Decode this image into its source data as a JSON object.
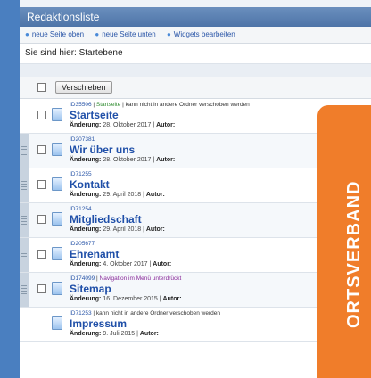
{
  "window": {
    "title": "Redaktionsliste"
  },
  "toolbar": {
    "links": [
      "neue Seite oben",
      "neue Seite unten",
      "Widgets bearbeiten"
    ]
  },
  "breadcrumb": "Sie sind hier: Startebene",
  "actions": {
    "move_button": "Verschieben"
  },
  "labels": {
    "change": "Änderung:",
    "author": "Autor:"
  },
  "rows": [
    {
      "id": "ID35506",
      "status": "Startseite",
      "note": "kann nicht in andere Ordner verschoben werden",
      "title": "Startseite",
      "date": "28. Oktober 2017"
    },
    {
      "id": "ID207381",
      "status": "",
      "note": "",
      "title": "Wir über uns",
      "date": "28. Oktober 2017"
    },
    {
      "id": "ID71255",
      "status": "",
      "note": "",
      "title": "Kontakt",
      "date": "29. April 2018"
    },
    {
      "id": "ID71254",
      "status": "",
      "note": "",
      "title": "Mitgliedschaft",
      "date": "29. April 2018"
    },
    {
      "id": "ID205677",
      "status": "",
      "note": "",
      "title": "Ehrenamt",
      "date": "4. Oktober 2017"
    },
    {
      "id": "ID174099",
      "status": "Navigation im Menü unterdrückt",
      "note": "",
      "title": "Sitemap",
      "date": "16. Dezember 2015"
    },
    {
      "id": "ID71253",
      "status": "",
      "note": "kann nicht in andere Ordner verschoben werden",
      "title": "Impressum",
      "date": "9. Juli 2015"
    }
  ],
  "banner": {
    "text": "ORTSVERBAND",
    "color": "#f07d2a"
  }
}
